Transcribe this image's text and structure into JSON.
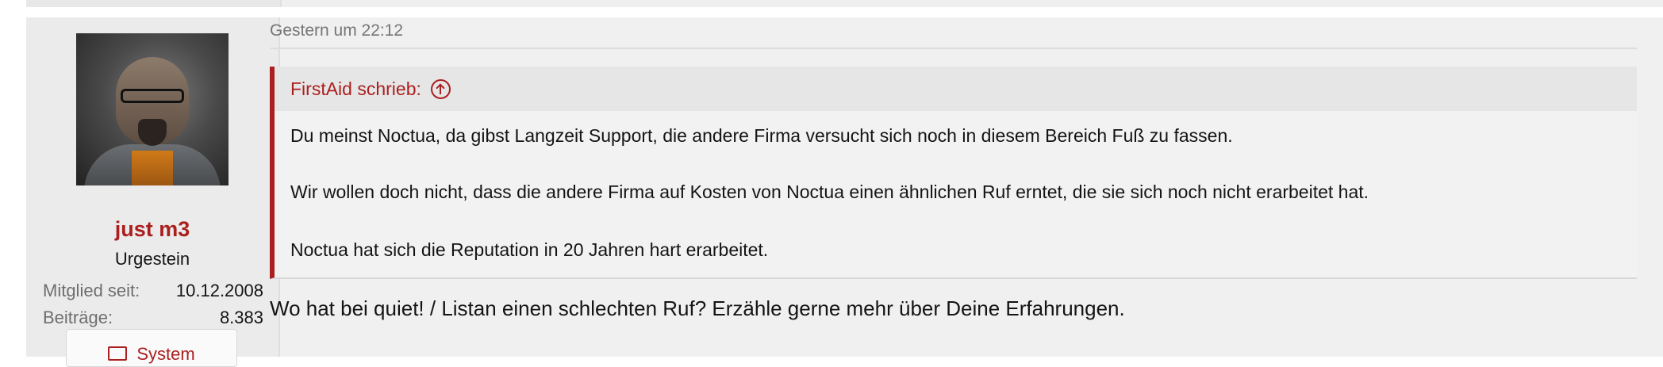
{
  "post": {
    "user": {
      "avatar_icon": "user-avatar",
      "name": "just m3",
      "title": "Urgestein",
      "stats": [
        {
          "label": "Mitglied seit:",
          "value": "10.12.2008"
        },
        {
          "label": "Beiträge:",
          "value": "8.383"
        }
      ],
      "system_button": {
        "icon": "monitor-icon",
        "label": "System"
      }
    },
    "date": "Gestern um 22:12",
    "quote": {
      "author_line": "FirstAid schrieb:",
      "jump_icon": "arrow-up-circle-icon",
      "lines": [
        "Du meinst Noctua, da gibst Langzeit Support, die andere Firma versucht sich noch in diesem Bereich Fuß zu fassen.",
        "Wir wollen doch nicht, dass die andere Firma auf Kosten von Noctua einen ähnlichen Ruf erntet, die sie sich noch nicht erarbeitet hat.",
        "Noctua hat sich die Reputation in 20 Jahren hart erarbeitet."
      ]
    },
    "reply": "Wo hat bei quiet! / Listan einen schlechten Ruf? Erzähle gerne mehr über Deine Erfahrungen."
  },
  "colors": {
    "accent": "#ab1f1f",
    "text": "#141414",
    "muted": "#767676",
    "background": "#f0f0f0"
  }
}
